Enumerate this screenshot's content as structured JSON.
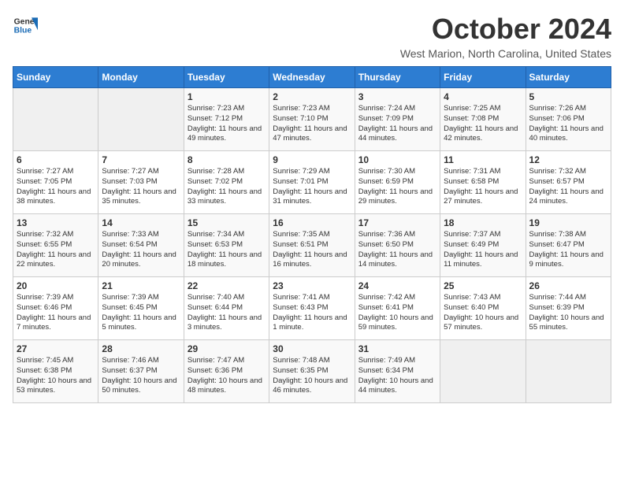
{
  "app": {
    "name": "GeneralBlue",
    "logo_shape": "blue triangle"
  },
  "header": {
    "month": "October 2024",
    "location": "West Marion, North Carolina, United States"
  },
  "days_of_week": [
    "Sunday",
    "Monday",
    "Tuesday",
    "Wednesday",
    "Thursday",
    "Friday",
    "Saturday"
  ],
  "weeks": [
    [
      {
        "day": "",
        "text": ""
      },
      {
        "day": "",
        "text": ""
      },
      {
        "day": "1",
        "text": "Sunrise: 7:23 AM\nSunset: 7:12 PM\nDaylight: 11 hours and 49 minutes."
      },
      {
        "day": "2",
        "text": "Sunrise: 7:23 AM\nSunset: 7:10 PM\nDaylight: 11 hours and 47 minutes."
      },
      {
        "day": "3",
        "text": "Sunrise: 7:24 AM\nSunset: 7:09 PM\nDaylight: 11 hours and 44 minutes."
      },
      {
        "day": "4",
        "text": "Sunrise: 7:25 AM\nSunset: 7:08 PM\nDaylight: 11 hours and 42 minutes."
      },
      {
        "day": "5",
        "text": "Sunrise: 7:26 AM\nSunset: 7:06 PM\nDaylight: 11 hours and 40 minutes."
      }
    ],
    [
      {
        "day": "6",
        "text": "Sunrise: 7:27 AM\nSunset: 7:05 PM\nDaylight: 11 hours and 38 minutes."
      },
      {
        "day": "7",
        "text": "Sunrise: 7:27 AM\nSunset: 7:03 PM\nDaylight: 11 hours and 35 minutes."
      },
      {
        "day": "8",
        "text": "Sunrise: 7:28 AM\nSunset: 7:02 PM\nDaylight: 11 hours and 33 minutes."
      },
      {
        "day": "9",
        "text": "Sunrise: 7:29 AM\nSunset: 7:01 PM\nDaylight: 11 hours and 31 minutes."
      },
      {
        "day": "10",
        "text": "Sunrise: 7:30 AM\nSunset: 6:59 PM\nDaylight: 11 hours and 29 minutes."
      },
      {
        "day": "11",
        "text": "Sunrise: 7:31 AM\nSunset: 6:58 PM\nDaylight: 11 hours and 27 minutes."
      },
      {
        "day": "12",
        "text": "Sunrise: 7:32 AM\nSunset: 6:57 PM\nDaylight: 11 hours and 24 minutes."
      }
    ],
    [
      {
        "day": "13",
        "text": "Sunrise: 7:32 AM\nSunset: 6:55 PM\nDaylight: 11 hours and 22 minutes."
      },
      {
        "day": "14",
        "text": "Sunrise: 7:33 AM\nSunset: 6:54 PM\nDaylight: 11 hours and 20 minutes."
      },
      {
        "day": "15",
        "text": "Sunrise: 7:34 AM\nSunset: 6:53 PM\nDaylight: 11 hours and 18 minutes."
      },
      {
        "day": "16",
        "text": "Sunrise: 7:35 AM\nSunset: 6:51 PM\nDaylight: 11 hours and 16 minutes."
      },
      {
        "day": "17",
        "text": "Sunrise: 7:36 AM\nSunset: 6:50 PM\nDaylight: 11 hours and 14 minutes."
      },
      {
        "day": "18",
        "text": "Sunrise: 7:37 AM\nSunset: 6:49 PM\nDaylight: 11 hours and 11 minutes."
      },
      {
        "day": "19",
        "text": "Sunrise: 7:38 AM\nSunset: 6:47 PM\nDaylight: 11 hours and 9 minutes."
      }
    ],
    [
      {
        "day": "20",
        "text": "Sunrise: 7:39 AM\nSunset: 6:46 PM\nDaylight: 11 hours and 7 minutes."
      },
      {
        "day": "21",
        "text": "Sunrise: 7:39 AM\nSunset: 6:45 PM\nDaylight: 11 hours and 5 minutes."
      },
      {
        "day": "22",
        "text": "Sunrise: 7:40 AM\nSunset: 6:44 PM\nDaylight: 11 hours and 3 minutes."
      },
      {
        "day": "23",
        "text": "Sunrise: 7:41 AM\nSunset: 6:43 PM\nDaylight: 11 hours and 1 minute."
      },
      {
        "day": "24",
        "text": "Sunrise: 7:42 AM\nSunset: 6:41 PM\nDaylight: 10 hours and 59 minutes."
      },
      {
        "day": "25",
        "text": "Sunrise: 7:43 AM\nSunset: 6:40 PM\nDaylight: 10 hours and 57 minutes."
      },
      {
        "day": "26",
        "text": "Sunrise: 7:44 AM\nSunset: 6:39 PM\nDaylight: 10 hours and 55 minutes."
      }
    ],
    [
      {
        "day": "27",
        "text": "Sunrise: 7:45 AM\nSunset: 6:38 PM\nDaylight: 10 hours and 53 minutes."
      },
      {
        "day": "28",
        "text": "Sunrise: 7:46 AM\nSunset: 6:37 PM\nDaylight: 10 hours and 50 minutes."
      },
      {
        "day": "29",
        "text": "Sunrise: 7:47 AM\nSunset: 6:36 PM\nDaylight: 10 hours and 48 minutes."
      },
      {
        "day": "30",
        "text": "Sunrise: 7:48 AM\nSunset: 6:35 PM\nDaylight: 10 hours and 46 minutes."
      },
      {
        "day": "31",
        "text": "Sunrise: 7:49 AM\nSunset: 6:34 PM\nDaylight: 10 hours and 44 minutes."
      },
      {
        "day": "",
        "text": ""
      },
      {
        "day": "",
        "text": ""
      }
    ]
  ]
}
